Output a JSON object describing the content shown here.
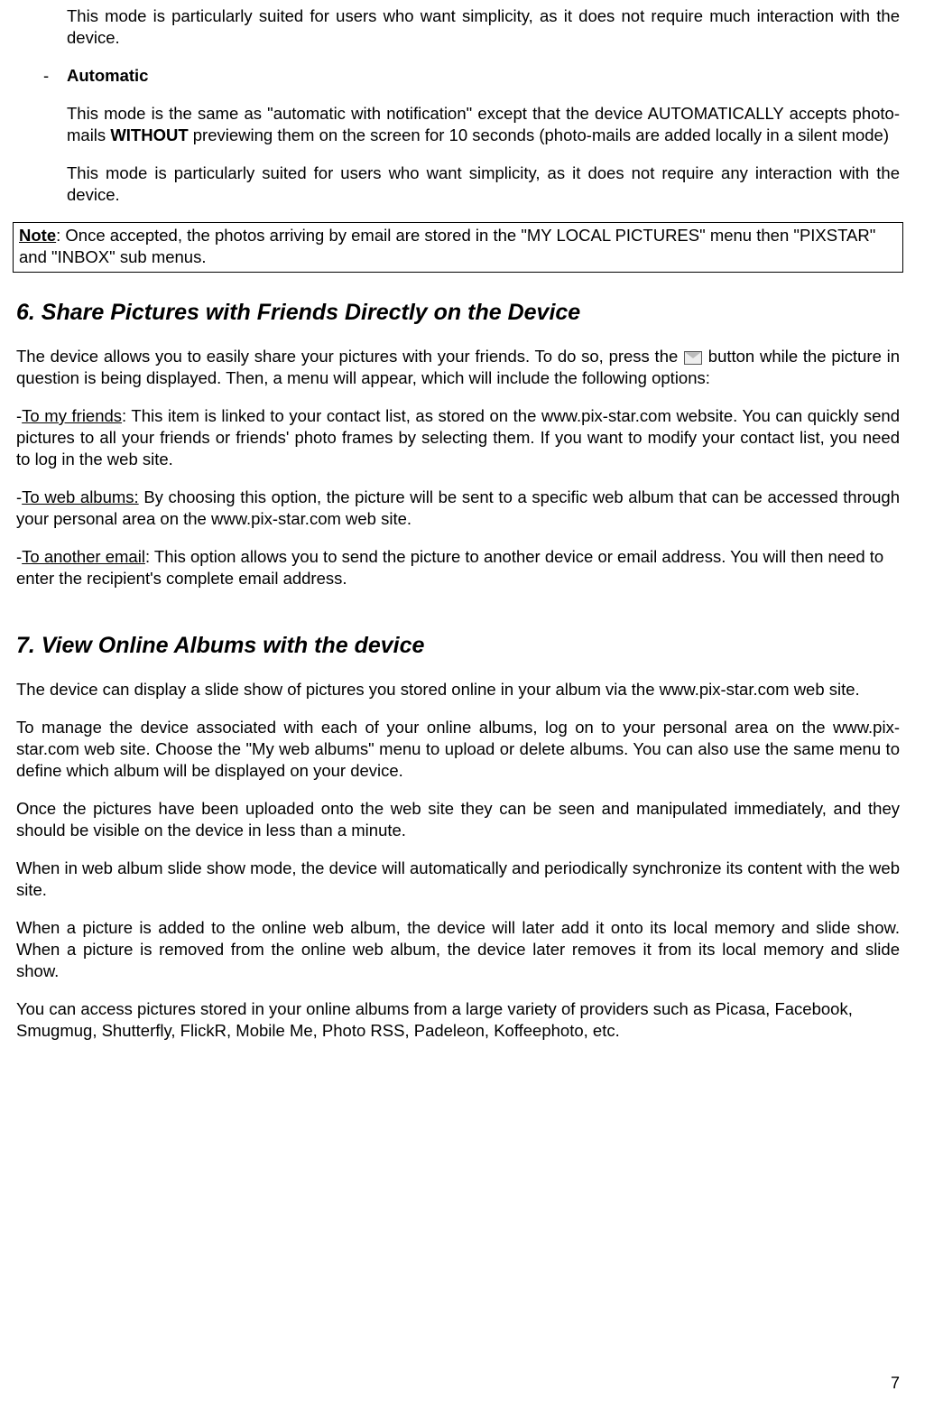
{
  "intro_para": "This mode is particularly suited for users who want simplicity, as it does not require much interaction with the device.",
  "bullet_label": "Automatic",
  "auto_p1_a": "This mode is the same as \"automatic with notification\" except that the device AUTOMATICALLY accepts photo-mails ",
  "auto_p1_bold": "WITHOUT",
  "auto_p1_b": " previewing them on the screen for 10 seconds (photo-mails are added locally in a silent mode)",
  "auto_p2": "This mode is particularly suited for users who want simplicity, as it does not require any interaction with the device.",
  "note_label": "Note",
  "note_text": ": Once accepted, the photos arriving by email are stored in the \"MY LOCAL PICTURES\" menu then \"PIXSTAR\" and \"INBOX\" sub menus.",
  "h6": "6. Share Pictures with Friends Directly on the Device",
  "s6_p1_a": "The device allows you to easily share your pictures with your friends. To do so, press the ",
  "s6_p1_b": " button while the picture in question is being displayed. Then, a menu will appear, which will include the following options:",
  "s6_friends_label": "To my friends",
  "s6_friends_text": ": This item is linked to your contact list, as stored on the www.pix-star.com website. You can quickly send pictures to all your friends or friends' photo frames by selecting them. If you want to modify your contact list, you need to log in the web site.",
  "s6_webalbums_label": "To web albums:",
  "s6_webalbums_text": " By choosing this option, the picture will be sent to a specific web album that can be accessed through your personal area on the www.pix-star.com web site.",
  "s6_email_label": "To another email",
  "s6_email_text": ": This option allows you to send the picture to another device or email address. You will then need to enter the recipient's complete email address.",
  "h7": "7. View Online Albums with the device",
  "s7_p1": "The device can display a slide show of pictures you stored online in your album via the www.pix-star.com web site.",
  "s7_p2": "To manage the device associated with each of your online albums, log on to your personal area on the www.pix-star.com web site. Choose the \"My web albums\" menu to upload or delete albums. You can also use the same menu to define which album will be displayed on your device.",
  "s7_p3": "Once the pictures have been uploaded onto the web site they can be seen and manipulated immediately, and they should be visible on the device in less than a minute.",
  "s7_p4": "When in web album slide show mode, the device will automatically and periodically synchronize its content with the web site.",
  "s7_p5": "When a picture is added to the online web album, the device will later add it onto its local memory and slide show. When a picture is removed from the online web album, the device later removes it from its local memory and slide show.",
  "s7_p6": "You can access pictures stored in your online albums from a large variety of providers such as Picasa, Facebook, Smugmug, Shutterfly, FlickR, Mobile Me, Photo RSS, Padeleon, Koffeephoto, etc.",
  "page_number": "7"
}
